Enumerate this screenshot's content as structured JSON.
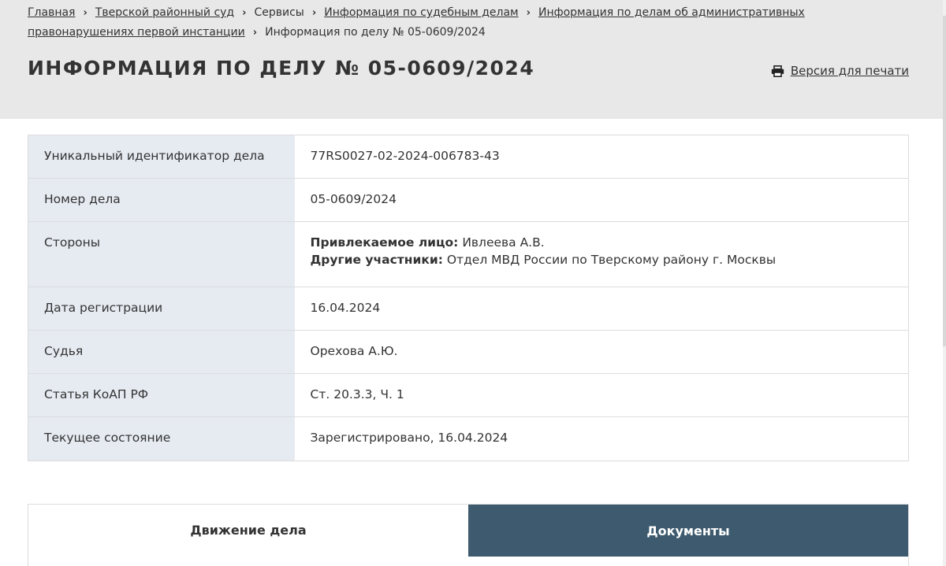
{
  "breadcrumb": {
    "items": [
      {
        "label": "Главная",
        "link": true
      },
      {
        "label": "Тверской районный суд",
        "link": true
      },
      {
        "label": "Сервисы",
        "link": false
      },
      {
        "label": "Информация по судебным делам",
        "link": true
      },
      {
        "label": "Информация по делам об административных правонарушениях первой инстанции",
        "link": true
      },
      {
        "label": "Информация по делу № 05-0609/2024",
        "link": false
      }
    ],
    "separator": "›"
  },
  "page": {
    "title": "ИНФОРМАЦИЯ ПО ДЕЛУ № 05-0609/2024",
    "print_label": "Версия для печати"
  },
  "case": {
    "rows": [
      {
        "key": "Уникальный идентификатор дела",
        "value": "77RS0027-02-2024-006783-43"
      },
      {
        "key": "Номер дела",
        "value": "05-0609/2024"
      },
      {
        "key": "Стороны",
        "parties": [
          {
            "role": "Привлекаемое лицо:",
            "name": "Ивлеева А.В."
          },
          {
            "role": "Другие участники:",
            "name": "Отдел МВД России по Тверскому району г. Москвы"
          }
        ]
      },
      {
        "key": "Дата регистрации",
        "value": "16.04.2024"
      },
      {
        "key": "Судья",
        "value": "Орехова А.Ю."
      },
      {
        "key": "Статья КоАП РФ",
        "value": "Ст. 20.3.3, Ч. 1"
      },
      {
        "key": "Текущее состояние",
        "value": "Зарегистрировано, 16.04.2024"
      }
    ]
  },
  "tabs": {
    "movement": "Движение дела",
    "documents": "Документы"
  },
  "colors": {
    "header_bg": "#e8e8e8",
    "key_cell_bg": "#e6ebf2",
    "active_tab_bg": "#3d5a6e"
  },
  "icons": {
    "print": "printer-icon",
    "breadcrumb_separator": "chevron-right-icon"
  }
}
